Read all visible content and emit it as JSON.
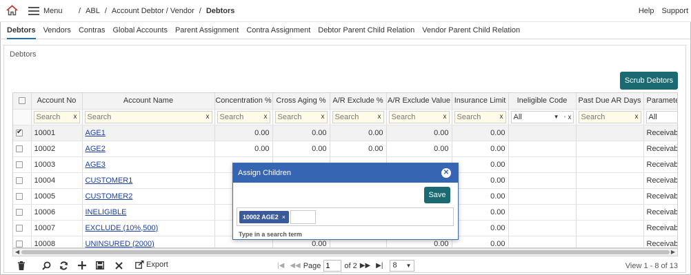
{
  "header": {
    "menu_label": "Menu",
    "breadcrumb": [
      "ABL",
      "Account Debtor / Vendor",
      "Debtors"
    ],
    "links": [
      "Help",
      "Support"
    ]
  },
  "tabs": [
    "Debtors",
    "Vendors",
    "Contras",
    "Global Accounts",
    "Parent Assignment",
    "Contra Assignment",
    "Debtor Parent Child Relation",
    "Vendor Parent Child Relation"
  ],
  "panel": {
    "title": "Debtors",
    "scrub_button": "Scrub Debtors"
  },
  "grid": {
    "columns": [
      "Account No",
      "Account Name",
      "Concentration %",
      "Cross Aging %",
      "A/R Exclude %",
      "A/R Exclude Value",
      "Insurance Limit",
      "Ineligible Code",
      "Past Due AR Days",
      "Parameter"
    ],
    "search_placeholder": "Search",
    "select_all_value": "All",
    "rows": [
      {
        "acct": "10001",
        "name": "AGE1",
        "conc": "0.00",
        "cross": "0.00",
        "arx": "0.00",
        "arxv": "0.00",
        "ins": "0.00",
        "param": "Receivables",
        "checked": true
      },
      {
        "acct": "10002",
        "name": "AGE2",
        "conc": "0.00",
        "cross": "0.00",
        "arx": "0.00",
        "arxv": "0.00",
        "ins": "0.00",
        "param": "Receivables",
        "checked": false
      },
      {
        "acct": "10003",
        "name": "AGE3",
        "conc": "",
        "cross": "",
        "arx": "",
        "arxv": "",
        "ins": "0.00",
        "param": "Receivables",
        "checked": false
      },
      {
        "acct": "10004",
        "name": "CUSTOMER1",
        "conc": "",
        "cross": "",
        "arx": "",
        "arxv": "",
        "ins": "0.00",
        "param": "Receivables",
        "checked": false
      },
      {
        "acct": "10005",
        "name": "CUSTOMER2",
        "conc": "",
        "cross": "",
        "arx": "",
        "arxv": "",
        "ins": "0.00",
        "param": "Receivables",
        "checked": false
      },
      {
        "acct": "10006",
        "name": "INELIGIBLE",
        "conc": "",
        "cross": "",
        "arx": "",
        "arxv": "",
        "ins": "0.00",
        "param": "Receivables",
        "checked": false
      },
      {
        "acct": "10007",
        "name": "EXCLUDE (10%,500)",
        "conc": "",
        "cross": "",
        "arx": "",
        "arxv": "",
        "ins": "0.00",
        "param": "Receivables",
        "checked": false
      },
      {
        "acct": "10008",
        "name": "UNINSURED (2000)",
        "conc": "",
        "cross": "0.00",
        "arx": "",
        "arxv": "0.00",
        "ins": "0.00",
        "param": "Receivables",
        "checked": false
      }
    ]
  },
  "pager": {
    "export_label": "Export",
    "page_label": "Page",
    "page_value": "1",
    "of_label": "of 2",
    "rows_per_page": "8",
    "view_info": "View 1 - 8 of 13"
  },
  "modal": {
    "title": "Assign Children",
    "save_label": "Save",
    "chip_label": "10002 AGE2",
    "chip_remove": "×",
    "search_hint": "Type in a search term"
  },
  "colors": {
    "teal_button": "#1b6a72",
    "modal_header": "#3665b3",
    "chip": "#3a5a99",
    "link": "#1a3fa6",
    "active_tab_underline": "#1a6fb0"
  }
}
